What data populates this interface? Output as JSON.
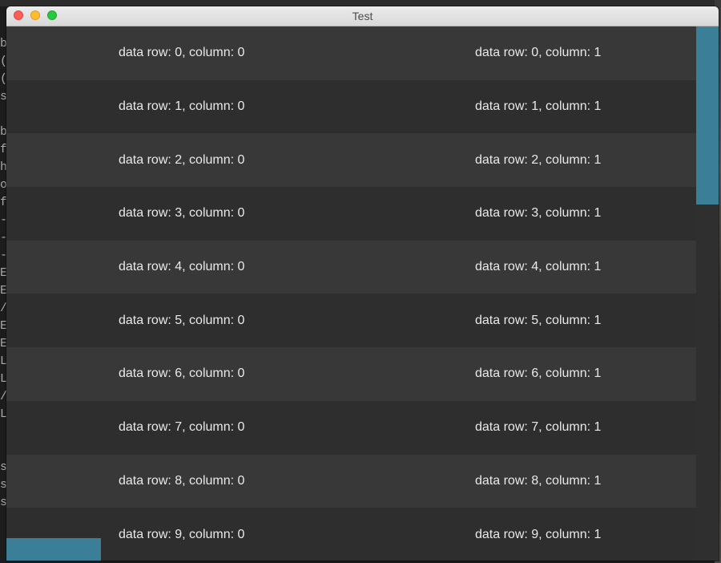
{
  "window": {
    "title": "Test"
  },
  "background_terminal": {
    "glyphs": [
      "b",
      "(",
      "(",
      "s",
      "",
      "b",
      "f",
      "h",
      "o",
      "f",
      "-",
      "-",
      "-",
      "E",
      "E",
      "/",
      "E",
      "E",
      "L",
      "L",
      "/",
      "L",
      "",
      "",
      "s",
      "s",
      "s"
    ]
  },
  "table": {
    "rows": [
      {
        "col0": "data row: 0, column: 0",
        "col1": "data row: 0, column: 1"
      },
      {
        "col0": "data row: 1, column: 0",
        "col1": "data row: 1, column: 1"
      },
      {
        "col0": "data row: 2, column: 0",
        "col1": "data row: 2, column: 1"
      },
      {
        "col0": "data row: 3, column: 0",
        "col1": "data row: 3, column: 1"
      },
      {
        "col0": "data row: 4, column: 0",
        "col1": "data row: 4, column: 1"
      },
      {
        "col0": "data row: 5, column: 0",
        "col1": "data row: 5, column: 1"
      },
      {
        "col0": "data row: 6, column: 0",
        "col1": "data row: 6, column: 1"
      },
      {
        "col0": "data row: 7, column: 0",
        "col1": "data row: 7, column: 1"
      },
      {
        "col0": "data row: 8, column: 0",
        "col1": "data row: 8, column: 1"
      },
      {
        "col0": "data row: 9, column: 0",
        "col1": "data row: 9, column: 1"
      }
    ]
  },
  "colors": {
    "row_odd": "#383838",
    "row_even": "#2e2e2e",
    "scrollbar_thumb": "#3a7e98",
    "text": "#e9e9e9"
  }
}
